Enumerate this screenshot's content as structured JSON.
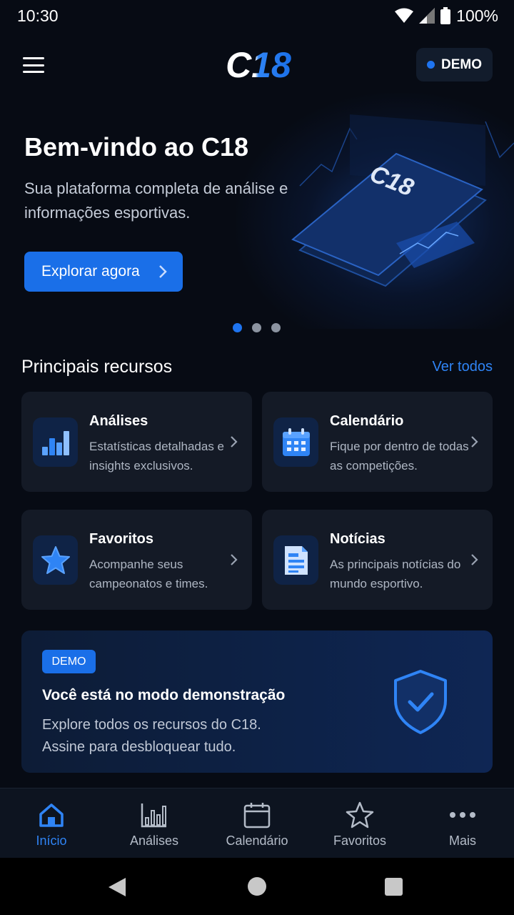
{
  "status_bar": {
    "time": "10:30",
    "battery": "100%"
  },
  "header": {
    "logo": "C18",
    "demo_label": "DEMO"
  },
  "hero": {
    "title": "Bem-vindo ao C18",
    "subtitle": "Sua plataforma completa de análise e informações esportivas.",
    "cta_label": "Explorar agora",
    "art_logo": "C18",
    "carousel_active_index": 0,
    "carousel_count": 3
  },
  "features": {
    "title": "Principais recursos",
    "see_all": "Ver todos",
    "items": [
      {
        "title": "Análises",
        "description": "Estatísticas detalhadas e insights exclusivos.",
        "icon": "bar-chart-icon"
      },
      {
        "title": "Calendário",
        "description": "Fique por dentro de todas as competições.",
        "icon": "calendar-icon"
      },
      {
        "title": "Favoritos",
        "description": "Acompanhe seus campeonatos e times.",
        "icon": "star-icon"
      },
      {
        "title": "Notícias",
        "description": "As principais notícias do mundo esportivo.",
        "icon": "news-icon"
      }
    ]
  },
  "demo_banner": {
    "badge": "DEMO",
    "title": "Você está no modo demonstração",
    "line1": "Explore todos os recursos do C18.",
    "line2": "Assine para desbloquear tudo."
  },
  "bottom_nav": {
    "items": [
      {
        "label": "Início",
        "icon": "home-icon",
        "active": true
      },
      {
        "label": "Análises",
        "icon": "bar-chart-icon",
        "active": false
      },
      {
        "label": "Calendário",
        "icon": "calendar-icon",
        "active": false
      },
      {
        "label": "Favoritos",
        "icon": "star-icon",
        "active": false
      },
      {
        "label": "Mais",
        "icon": "more-icon",
        "active": false
      }
    ]
  },
  "colors": {
    "accent": "#1a6fe8",
    "background": "#070b14",
    "card": "#141a26"
  }
}
